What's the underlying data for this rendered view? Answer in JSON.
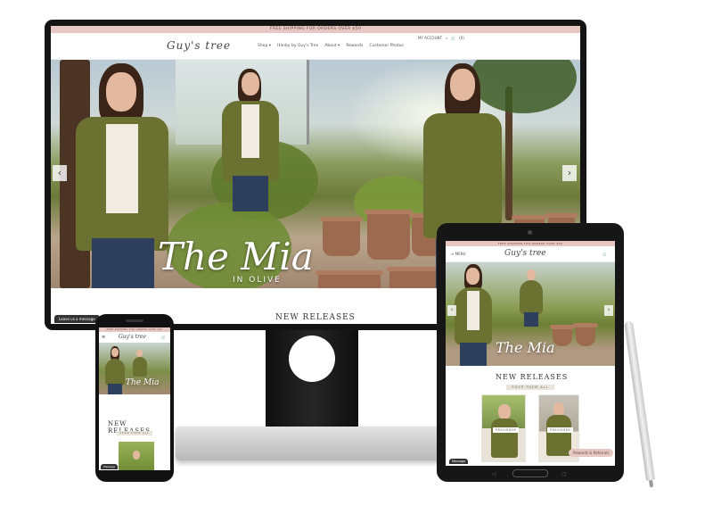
{
  "site": {
    "shipping_banner": "FREE SHIPPING FOR ORDERS OVER $50",
    "logo": "Guy's tree",
    "nav": [
      "Shop ▾",
      "Hanby by Guy's Tree",
      "About ▾",
      "Rewards",
      "Customer Photos"
    ],
    "account": "MY ACCOUNT",
    "cart": "(0)"
  },
  "hero": {
    "title": "The Mia",
    "subtitle": "IN OLIVE"
  },
  "section": {
    "new_releases": "NEW RELEASES",
    "shop_all": "SHOP THEM ALL"
  },
  "chat": {
    "leave_message": "Leave us a message",
    "message_short": "Message"
  },
  "tablet": {
    "menu": "≡ MENU",
    "preorder": "PREORDER",
    "rewards": "Rewards & Referrals"
  },
  "icons": {
    "prev": "chevron-left-icon",
    "next": "chevron-right-icon",
    "search": "search-icon",
    "cart": "cart-icon"
  },
  "colors": {
    "banner": "#e7c7c1",
    "device": "#141414",
    "jacket": "#6b7131"
  }
}
